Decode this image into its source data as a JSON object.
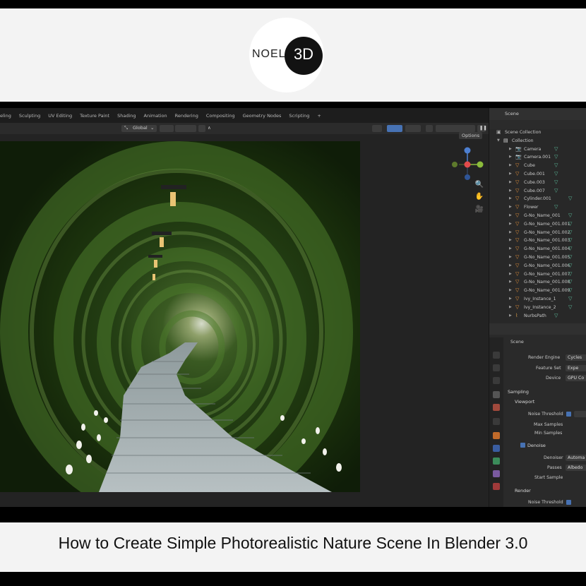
{
  "logo": {
    "left_text": "NOEL",
    "right_text": "3D"
  },
  "video_title": "How to Create Simple Photorealistic Nature Scene In Blender 3.0",
  "workspace_tabs": [
    "eling",
    "Sculpting",
    "UV Editing",
    "Texture Paint",
    "Shading",
    "Animation",
    "Rendering",
    "Compositing",
    "Geometry Nodes",
    "Scripting",
    "+"
  ],
  "viewport": {
    "orientation": "Global",
    "options": "Options"
  },
  "outliner": {
    "scene_name": "Scene",
    "root": "Scene Collection",
    "collection": "Collection",
    "items": [
      "Camera",
      "Camera.001",
      "Cube",
      "Cube.001",
      "Cube.003",
      "Cube.007",
      "Cylinder.001",
      "Flower",
      "G-No_Name_001",
      "G-No_Name_001.001",
      "G-No_Name_001.002",
      "G-No_Name_001.003",
      "G-No_Name_001.004",
      "G-No_Name_001.005",
      "G-No_Name_001.006",
      "G-No_Name_001.007",
      "G-No_Name_001.008",
      "G-No_Name_001.009",
      "Ivy_Instance_1",
      "Ivy_Instance_2",
      "NurbsPath"
    ]
  },
  "properties": {
    "context": "Scene",
    "render_engine_label": "Render Engine",
    "render_engine_value": "Cycles",
    "feature_set_label": "Feature Set",
    "feature_set_value": "Expe",
    "device_label": "Device",
    "device_value": "GPU Co",
    "sampling": "Sampling",
    "viewport_section": "Viewport",
    "noise_threshold": "Noise Threshold",
    "max_samples": "Max Samples",
    "min_samples": "Min Samples",
    "denoise": "Denoise",
    "denoiser_label": "Denoiser",
    "denoiser_value": "Automa",
    "passes_label": "Passes",
    "passes_value": "Albedo",
    "start_sample": "Start Sample",
    "render_section": "Render",
    "noise_threshold_2": "Noise Threshold"
  },
  "colors": {
    "accent": "#4772b3",
    "panel": "#282828",
    "band": "#f3f3f3"
  }
}
